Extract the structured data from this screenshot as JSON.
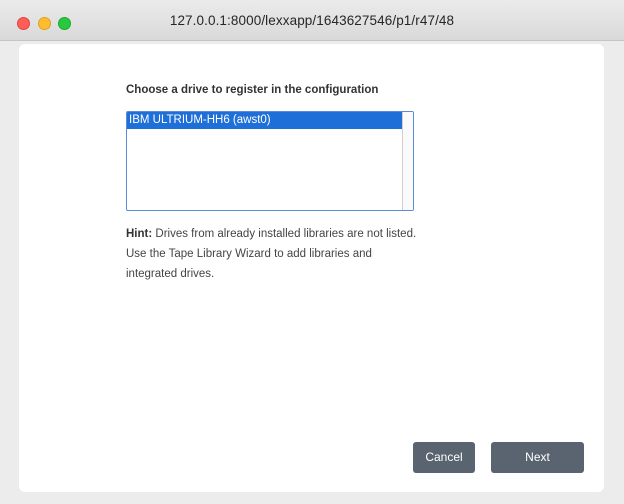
{
  "window": {
    "title": "127.0.0.1:8000/lexxapp/1643627546/p1/r47/48"
  },
  "dialog": {
    "prompt": "Choose a drive to register in the configuration",
    "drives": [
      {
        "label": "IBM ULTRIUM-HH6 (awst0)",
        "selected": true
      }
    ],
    "hint_label": "Hint:",
    "hint_text": " Drives from already installed libraries are not listed. Use the Tape Library Wizard to add libraries and integrated drives.",
    "cancel_label": "Cancel",
    "next_label": "Next"
  },
  "colors": {
    "selection": "#1f6fd9",
    "button": "#5a6370",
    "close": "#fd5f57",
    "minimize": "#febc2e",
    "zoom": "#28c840"
  }
}
